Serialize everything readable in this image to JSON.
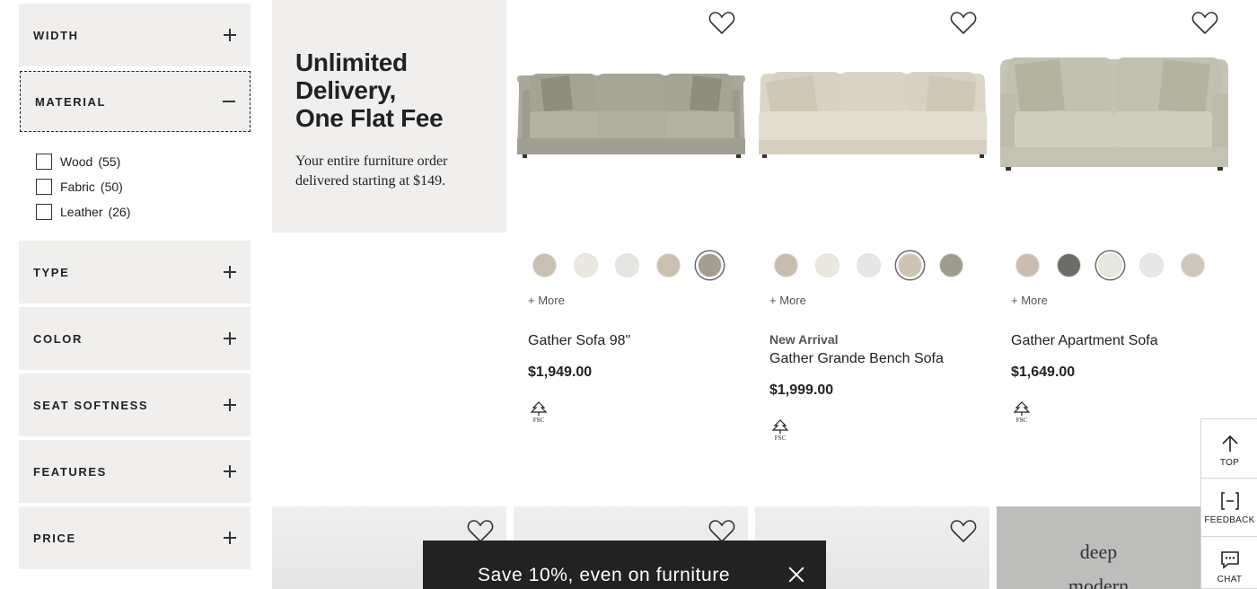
{
  "sidebar": {
    "filters": [
      {
        "label": "WIDTH"
      },
      {
        "label": "MATERIAL"
      },
      {
        "label": "TYPE"
      },
      {
        "label": "COLOR"
      },
      {
        "label": "SEAT SOFTNESS"
      },
      {
        "label": "FEATURES"
      },
      {
        "label": "PRICE"
      }
    ],
    "material_options": [
      {
        "label": "Wood",
        "count": "(55)"
      },
      {
        "label": "Fabric",
        "count": "(50)"
      },
      {
        "label": "Leather",
        "count": "(26)"
      }
    ]
  },
  "promo": {
    "title_line1": "Unlimited",
    "title_line2": "Delivery,",
    "title_line3": "One Flat Fee",
    "text": "Your entire furniture order delivered starting at $149."
  },
  "products": [
    {
      "name": "Gather Sofa 98\"",
      "price": "$1,949.00",
      "badge": "",
      "more": "+ More",
      "fsc": "FSC",
      "swatches": [
        "#c9bfb2",
        "#ebe8df",
        "#e5e5e4",
        "#cbbfae",
        "#a39e90"
      ],
      "selected_swatch": 4
    },
    {
      "name": "Gather Grande Bench Sofa",
      "price": "$1,999.00",
      "badge": "New Arrival",
      "more": "+ More",
      "fsc": "FSC",
      "swatches": [
        "#c9bdb0",
        "#ebe8dd",
        "#e6e6e5",
        "#cfc4b3",
        "#9f9c8c"
      ],
      "selected_swatch": 3
    },
    {
      "name": "Gather Apartment Sofa",
      "price": "$1,649.00",
      "badge": "",
      "more": "+ More",
      "fsc": "FSC",
      "swatches": [
        "#cbbdae",
        "#6e6c68",
        "#e8e8df",
        "#e8e8e8",
        "#d0c6b7"
      ],
      "selected_swatch": 2
    }
  ],
  "lower_tile": {
    "line1": "deep",
    "line2": "modern"
  },
  "banner": {
    "text": "Save 10%, even on furniture"
  },
  "rail": {
    "top": "TOP",
    "feedback": "FEEDBACK",
    "chat": "CHAT"
  },
  "colors": {
    "panel": "#f0efed",
    "banner": "#222222"
  }
}
